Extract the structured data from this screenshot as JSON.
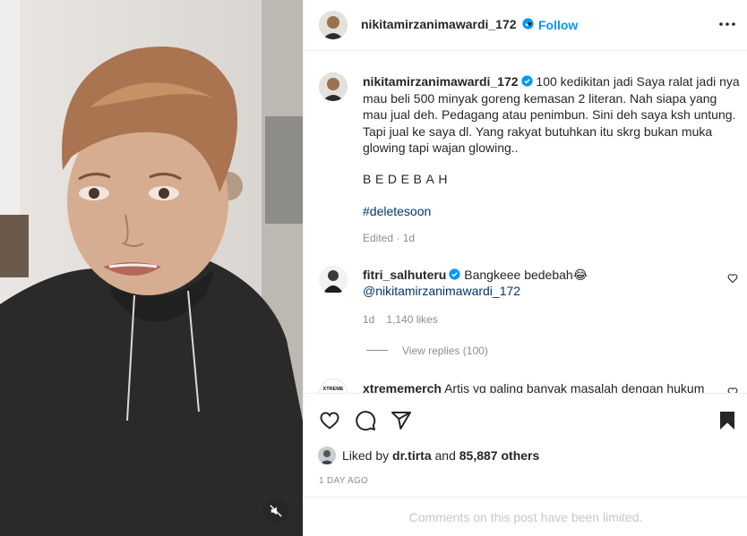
{
  "header": {
    "username": "nikitamirzanimawardi_172",
    "dot": "•",
    "follow_label": "Follow"
  },
  "caption": {
    "username": "nikitamirzanimawardi_172",
    "lines": [
      "100 kedikitan jadi Saya ralat jadi nya",
      "mau beli 500 minyak goreng kemasan 2 literan. Nah siapa yang",
      "mau jual deh. Pedagang atau penimbun. Sini deh saya ksh untung.",
      "Tapi jual ke saya dl. Yang rakyat butuhkan itu skrg bukan muka",
      "glowing tapi wajan glowing.."
    ],
    "spaced_text": "BEDEBAH",
    "hashtag": "#deletesoon",
    "edited": "Edited · 1d"
  },
  "comments": [
    {
      "username": "fitri_salhuteru",
      "text": "Bangkeee bedebah😂",
      "mention": "@nikitamirzanimawardi_172",
      "age": "1d",
      "likes": "1,140 likes",
      "view_replies": "View replies (100)"
    },
    {
      "username": "xtrememerch",
      "text": "Artis yg paling banyak masalah dengan hukum",
      "avatar_text": "XTREME"
    }
  ],
  "likes": {
    "prefix": "Liked by",
    "liker": "dr.tirta",
    "conj": "and",
    "others": "85,887 others"
  },
  "time_ago": "1 DAY AGO",
  "comments_limited": "Comments on this post have been limited.",
  "icons": {
    "verified": "verified-badge-icon",
    "more": "more-options-icon",
    "like": "heart-icon",
    "comment": "comment-icon",
    "share": "share-icon",
    "save": "bookmark-icon",
    "mute": "muted-speaker-icon"
  },
  "colors": {
    "link_blue": "#0095f6",
    "hashtag_blue": "#00376b",
    "muted_gray": "#8e8e8e",
    "verified_blue": "#0095f6"
  }
}
